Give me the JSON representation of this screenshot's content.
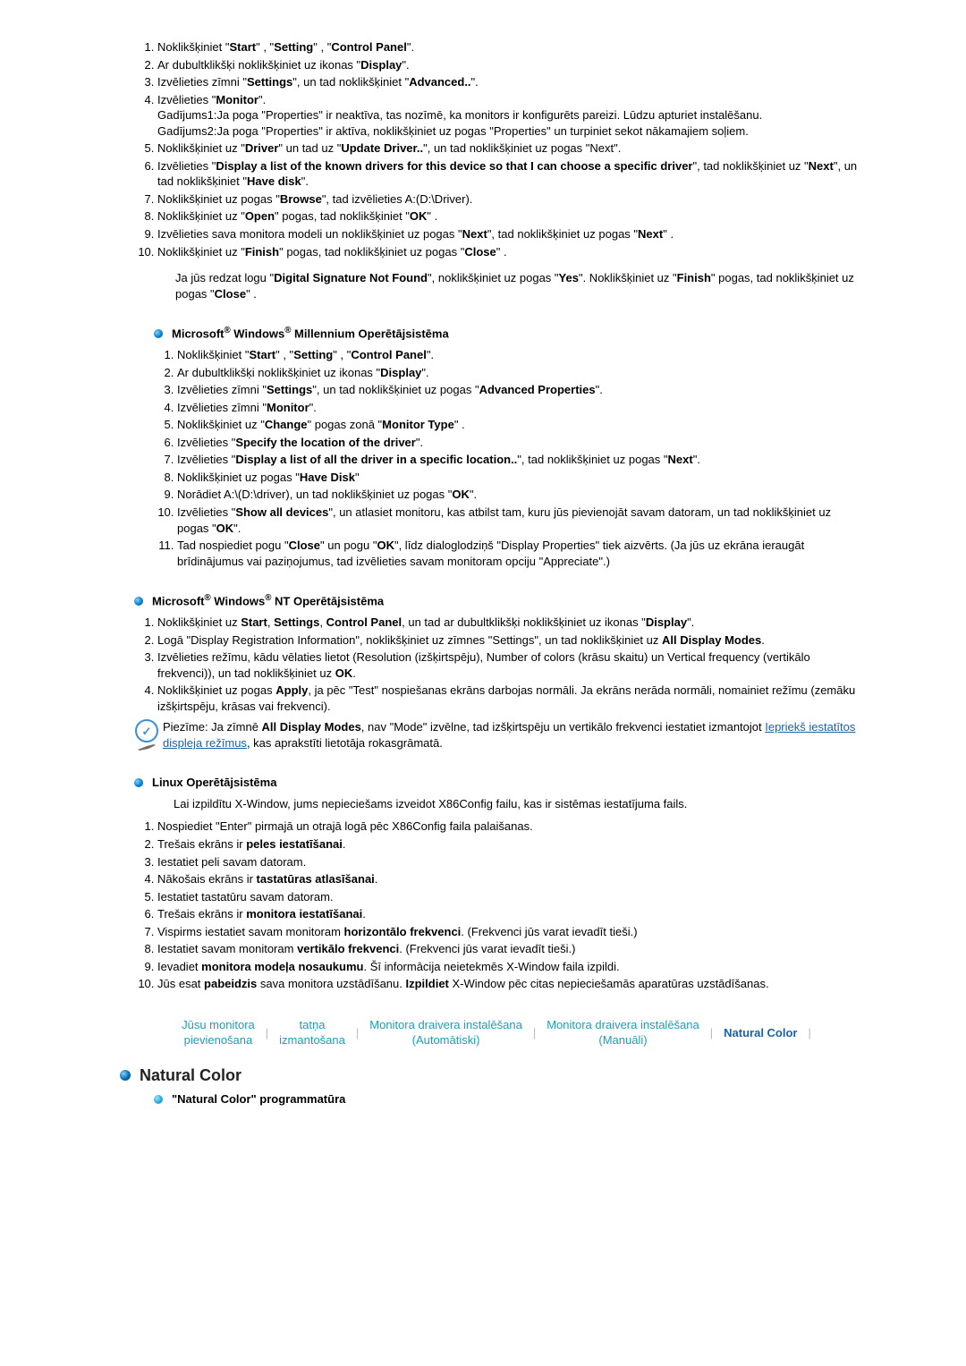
{
  "section1": {
    "items": [
      {
        "pre": "Noklikšķiniet \"",
        "b1": "Start",
        "mid1": "\" , \"",
        "b2": "Setting",
        "mid2": "\" , \"",
        "b3": "Control Panel",
        "post": "\"."
      },
      {
        "pre": "Ar dubultklikšķi noklikšķiniet uz ikonas \"",
        "b1": "Display",
        "post": "\"."
      },
      {
        "pre": "Izvēlieties zīmni \"",
        "b1": "Settings",
        "mid1": "\", un tad noklikšķiniet \"",
        "b2": "Advanced..",
        "post": "\"."
      }
    ],
    "item4": {
      "pre": "Izvēlieties \"",
      "b1": "Monitor",
      "post": "\"."
    },
    "case1": "Gadījums1:Ja poga \"Properties\" ir neaktīva, tas nozīmē, ka monitors ir konfigurēts pareizi. Lūdzu apturiet instalēšanu.",
    "case2": "Gadījums2:Ja poga \"Properties\" ir aktīva, noklikšķiniet uz pogas \"Properties\" un turpiniet sekot nākamajiem soļiem.",
    "items5": [
      "Noklikšķiniet uz \"<b>Driver</b>\" un tad uz \"<b>Update Driver..</b>\", un tad noklikšķiniet uz pogas \"Next\".",
      "Izvēlieties \"<b>Display a list of the known drivers for this device so that I can choose a specific driver</b>\", tad noklikšķiniet uz \"<b>Next</b>\", un tad noklikšķiniet \"<b>Have disk</b>\".",
      "Noklikšķiniet uz pogas \"<b>Browse</b>\", tad izvēlieties A:(D:\\Driver).",
      "Noklikšķiniet uz \"<b>Open</b>\" pogas, tad noklikšķiniet \"<b>OK</b>\" .",
      "Izvēlieties sava monitora modeli un noklikšķiniet uz pogas \"<b>Next</b>\", tad noklikšķiniet uz pogas \"<b>Next</b>\" .",
      "Noklikšķiniet uz \"<b>Finish</b>\" pogas, tad noklikšķiniet uz pogas \"<b>Close</b>\" ."
    ],
    "note": "Ja jūs redzat logu \"<b>Digital Signature Not Found</b>\", noklikšķiniet uz pogas \"<b>Yes</b>\". Noklikšķiniet uz \"<b>Finish</b>\" pogas, tad noklikšķiniet uz pogas \"<b>Close</b>\" ."
  },
  "me": {
    "title": "Microsoft<sup>®</sup> Windows<sup>®</sup> Millennium Operētājsistēma",
    "items": [
      "Noklikšķiniet \"<b>Start</b>\" , \"<b>Setting</b>\" , \"<b>Control Panel</b>\".",
      "Ar dubultklikšķi noklikšķiniet uz ikonas \"<b>Display</b>\".",
      "Izvēlieties zīmni \"<b>Settings</b>\", un tad noklikšķiniet uz pogas \"<b>Advanced Properties</b>\".",
      "Izvēlieties zīmni \"<b>Monitor</b>\".",
      "Noklikšķiniet uz \"<b>Change</b>\" pogas zonā \"<b>Monitor Type</b>\" .",
      "Izvēlieties \"<b>Specify the location of the driver</b>\".",
      "Izvēlieties \"<b>Display a list of all the driver in a specific location..</b>\", tad noklikšķiniet uz pogas \"<b>Next</b>\".",
      "Noklikšķiniet uz pogas \"<b>Have Disk</b>\"",
      "Norādiet A:\\(D:\\driver), un tad noklikšķiniet uz pogas \"<b>OK</b>\".",
      "Izvēlieties \"<b>Show all devices</b>\", un atlasiet monitoru, kas atbilst tam, kuru jūs pievienojāt savam datoram, un tad noklikšķiniet uz pogas \"<b>OK</b>\".",
      "Tad nospiediet pogu \"<b>Close</b>\" un pogu \"<b>OK</b>\", līdz dialoglodziņš \"Display Properties\" tiek aizvērts. (Ja jūs uz ekrāna ieraugāt brīdinājumus vai paziņojumus, tad izvēlieties savam monitoram opciju \"Appreciate\".)"
    ]
  },
  "nt": {
    "title": "Microsoft<sup>®</sup> Windows<sup>®</sup> NT Operētājsistēma",
    "items": [
      "Noklikšķiniet uz <b>Start</b>, <b>Settings</b>, <b>Control Panel</b>, un tad ar dubultklikšķi noklikšķiniet uz ikonas \"<b>Display</b>\".",
      "Logā \"Display Registration Information\", noklikšķiniet uz zīmnes \"Settings\", un tad noklikšķiniet uz <b>All Display Modes</b>.",
      "Izvēlieties režīmu, kādu vēlaties lietot (Resolution (izšķirtspēju), Number of colors (krāsu skaitu) un Vertical frequency (vertikālo frekvenci)), un tad noklikšķiniet uz <b>OK</b>.",
      "Noklikšķiniet uz pogas <b>Apply</b>, ja pēc \"Test\" nospiešanas ekrāns darbojas normāli. Ja ekrāns nerāda normāli, nomainiet režīmu (zemāku izšķirtspēju, krāsas vai frekvenci)."
    ],
    "note_pre": "Piezīme: Ja zīmnē ",
    "note_b": "All Display Modes",
    "note_mid": ", nav \"Mode\" izvēlne, tad izšķirtspēju un vertikālo frekvenci iestatiet izmantojot ",
    "note_link": "Iepriekš iestatītos displeja režīmus",
    "note_post": ", kas aprakstīti lietotāja rokasgrāmatā."
  },
  "linux": {
    "title": "Linux Operētājsistēma",
    "intro": "Lai izpildītu X-Window, jums nepieciešams izveidot X86Config failu, kas ir sistēmas iestatījuma fails.",
    "items": [
      "Nospiediet \"Enter\" pirmajā un otrajā logā pēc X86Config faila palaišanas.",
      "Trešais ekrāns ir <b>peles iestatīšanai</b>.",
      "Iestatiet peli savam datoram.",
      "Nākošais ekrāns ir <b>tastatūras atlasīšanai</b>.",
      "Iestatiet tastatūru savam datoram.",
      "Trešais ekrāns ir <b>monitora iestatīšanai</b>.",
      "Vispirms iestatiet savam monitoram <b>horizontālo frekvenci</b>. (Frekvenci jūs varat ievadīt tieši.)",
      "Iestatiet savam monitoram <b>vertikālo frekvenci</b>. (Frekvenci jūs varat ievadīt tieši.)",
      "Ievadiet <b>monitora modeļa nosaukumu</b>. Šī informācija neietekmēs X-Window faila izpildi.",
      "Jūs esat <b>pabeidzis</b> sava monitora uzstādīšanu. <b>Izpildiet</b> X-Window pēc citas nepieciešamās aparatūras uzstādīšanas."
    ]
  },
  "tabs": {
    "t1a": "Jūsu monitora",
    "t1b": "pievienošana",
    "t2a": "tatņa",
    "t2b": "izmantošana",
    "t3a": "Monitora draivera instalēšana",
    "t3b": "(Automātiski)",
    "t4a": "Monitora draivera instalēšana",
    "t4b": "(Manuāli)",
    "t5": "Natural Color"
  },
  "nc": {
    "title": "Natural Color",
    "sub": "\"Natural Color\" programmatūra"
  }
}
